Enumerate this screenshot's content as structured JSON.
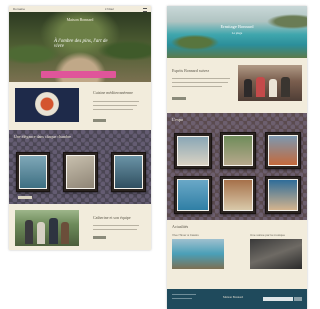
{
  "left_page": {
    "logo": "Domaine",
    "nav_right": "L'hôtel",
    "hero_title": "Maison Bonnard",
    "hero_tagline": "À l'ombre des pins, l'art de vivre",
    "cuisine_heading": "Cuisine méditerranéenne",
    "rooms_heading": "Une élégance dans chaque chambre",
    "team_heading": "Catherine et son équipe"
  },
  "right_page": {
    "hero_title": "Ermitage Bonnard",
    "hero_subtitle": "La plage",
    "story_heading": "Esprits Bonnard suivez",
    "gallery_heading": "L'expo",
    "news_heading": "Actualités",
    "news_item_1": "Vive l'hiver à Cassis",
    "news_item_2": "Une soirée par la musique",
    "footer_brand": "Maison Bonnard"
  },
  "colors": {
    "page_bg": "#f2ecdc",
    "wallpaper": "#4b4654",
    "footer": "#1f4a5c",
    "pink_accent": "#e0559a",
    "button": "#8a8a7a"
  }
}
